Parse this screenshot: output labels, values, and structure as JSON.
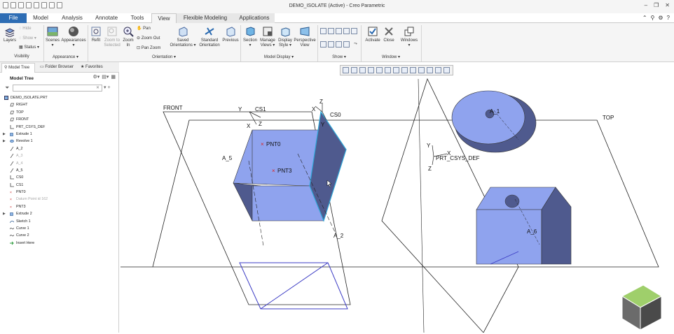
{
  "title": "DEMO_ISOLATE (Active) - Creo Parametric",
  "tabs": [
    {
      "label": "File"
    },
    {
      "label": "Model"
    },
    {
      "label": "Analysis"
    },
    {
      "label": "Annotate"
    },
    {
      "label": "Tools"
    },
    {
      "label": "View"
    },
    {
      "label": "Flexible Modeling"
    },
    {
      "label": "Applications"
    }
  ],
  "ribbon": {
    "visibility": {
      "group": "Visibility",
      "layers": "Layers",
      "hide": "Hide",
      "show": "Show",
      "status": "Status"
    },
    "appearance": {
      "group": "Appearance",
      "scenes": "Scenes",
      "appearances": "Appearances"
    },
    "orientation": {
      "group": "Orientation",
      "refit": "Refit",
      "zoom_to_selected": "Zoom to Selected",
      "zoom_in": "Zoom In",
      "pan": "Pan",
      "zoom_out": "Zoom Out",
      "pan_zoom": "Pan Zoom",
      "saved_orientations": "Saved Orientations",
      "standard_orientation": "Standard Orientation",
      "previous": "Previous"
    },
    "model_display": {
      "group": "Model Display",
      "section": "Section",
      "manage_views": "Manage Views",
      "display_style": "Display Style",
      "perspective_view": "Perspective View"
    },
    "show": {
      "group": "Show"
    },
    "window": {
      "group": "Window",
      "activate": "Activate",
      "close": "Close",
      "windows": "Windows"
    }
  },
  "panel": {
    "tabs": [
      "Model Tree",
      "Folder Browser",
      "Favorites"
    ],
    "header": "Model Tree",
    "items": [
      {
        "label": "DEMO_ISOLATE.PRT",
        "icon": "part-icon",
        "expand": "",
        "dim": false
      },
      {
        "label": "RIGHT",
        "icon": "datum-plane-icon",
        "expand": "",
        "dim": false
      },
      {
        "label": "TOP",
        "icon": "datum-plane-icon",
        "expand": "",
        "dim": false
      },
      {
        "label": "FRONT",
        "icon": "datum-plane-icon",
        "expand": "",
        "dim": false
      },
      {
        "label": "PRT_CSYS_DEF",
        "icon": "csys-icon",
        "expand": "",
        "dim": false
      },
      {
        "label": "Extrude 1",
        "icon": "extrude-icon",
        "expand": "▶",
        "dim": false
      },
      {
        "label": "Revolve 1",
        "icon": "revolve-icon",
        "expand": "▶",
        "dim": false
      },
      {
        "label": "A_2",
        "icon": "axis-icon",
        "expand": "",
        "dim": false
      },
      {
        "label": "A_3",
        "icon": "axis-icon",
        "expand": "",
        "dim": true
      },
      {
        "label": "A_4",
        "icon": "axis-icon",
        "expand": "",
        "dim": true
      },
      {
        "label": "A_5",
        "icon": "axis-icon",
        "expand": "",
        "dim": false
      },
      {
        "label": "CS0",
        "icon": "csys-icon",
        "expand": "",
        "dim": false
      },
      {
        "label": "CS1",
        "icon": "csys-icon",
        "expand": "",
        "dim": false
      },
      {
        "label": "PNT0",
        "icon": "datum-point-icon",
        "expand": "",
        "dim": false
      },
      {
        "label": "Datum Point id 162",
        "icon": "datum-point-icon",
        "expand": "",
        "dim": true
      },
      {
        "label": "PNT3",
        "icon": "datum-point-icon",
        "expand": "",
        "dim": false
      },
      {
        "label": "Extrude 2",
        "icon": "extrude-icon",
        "expand": "▶",
        "dim": false
      },
      {
        "label": "Sketch 1",
        "icon": "sketch-icon",
        "expand": "",
        "dim": false
      },
      {
        "label": "Curve 1",
        "icon": "curve-icon",
        "expand": "",
        "dim": false
      },
      {
        "label": "Curve 2",
        "icon": "curve-icon",
        "expand": "",
        "dim": false
      },
      {
        "label": "Insert Here",
        "icon": "insert-here-icon",
        "expand": "",
        "dim": false
      }
    ]
  },
  "viewport": {
    "labels": {
      "front": "FRONT",
      "top": "TOP",
      "prt_csys_def": "PRT_CSYS_DEF",
      "pnt0": "PNT0",
      "pnt3": "PNT3",
      "cs0": "CS0",
      "cs1": "CS1",
      "a5": "A_5",
      "a2": "A_2",
      "a1": "A_1",
      "a6": "A_6",
      "x": "X",
      "y": "Y",
      "z": "Z"
    }
  },
  "colors": {
    "file_tab": "#2E6DB4",
    "solid_face": "#8FA3EE",
    "solid_dark": "#4F5A8E",
    "highlight": "#2FA7D8",
    "sketch": "#3B3BC4"
  }
}
